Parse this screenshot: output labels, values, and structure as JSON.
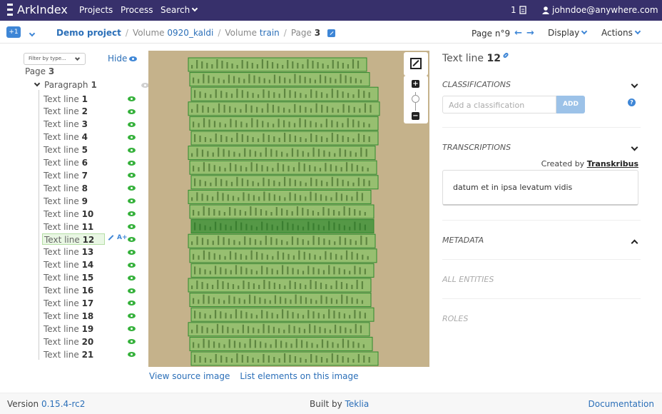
{
  "topbar": {
    "brand": "ArkIndex",
    "nav": [
      "Projects",
      "Process",
      "Search"
    ],
    "notifications_count": "1",
    "user": "johndoe@anywhere.com"
  },
  "breadcrumb": {
    "plus_label": "+1",
    "project": "Demo project",
    "volume_prefix": "Volume",
    "volume_name": "0920_kaldi",
    "volume2_prefix": "Volume",
    "volume2_name": "train",
    "page_prefix": "Page",
    "page_number": "3",
    "page_nav": "Page n°9",
    "display_menu": "Display",
    "actions_menu": "Actions"
  },
  "tree": {
    "filter_placeholder": "Filter by type...",
    "hide_label": "Hide",
    "page_label_prefix": "Page",
    "page_label_num": "3",
    "paragraph_prefix": "Paragraph",
    "paragraph_num": "1",
    "line_prefix": "Text line",
    "lines": [
      "1",
      "2",
      "3",
      "4",
      "5",
      "6",
      "7",
      "8",
      "9",
      "10",
      "11",
      "12",
      "13",
      "14",
      "15",
      "16",
      "17",
      "18",
      "19",
      "20",
      "21"
    ],
    "selected_index": 11,
    "annotate_label": "A+"
  },
  "image_links": {
    "view_source": "View source image",
    "list_elements": "List elements on this image"
  },
  "details": {
    "title_prefix": "Text line",
    "title_num": "12",
    "classifications_heading": "CLASSIFICATIONS",
    "classification_placeholder": "Add a classification",
    "add_button": "ADD",
    "help_glyph": "?",
    "transcriptions_heading": "TRANSCRIPTIONS",
    "created_by_prefix": "Created by",
    "created_by_name": "Transkribus",
    "transcription_text": "datum et in ipsa levatum vidis",
    "metadata_heading": "METADATA",
    "entities_heading": "ALL ENTITIES",
    "roles_heading": "ROLES"
  },
  "footer": {
    "version_prefix": "Version",
    "version": "0.15.4-rc2",
    "built_prefix": "Built by",
    "built_by": "Teklia",
    "documentation": "Documentation"
  },
  "colors": {
    "topbar_bg": "#37306b",
    "accent_blue": "#3e86d6",
    "visible_green": "#35b13b",
    "selected_line_bg": "#e9f7e4",
    "manuscript_bg": "#c5b28b"
  }
}
